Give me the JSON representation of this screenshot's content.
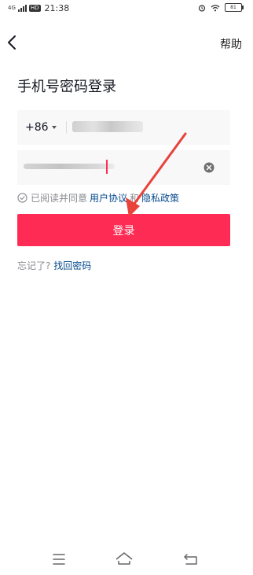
{
  "status_bar": {
    "network": "4G",
    "hd": "HD",
    "time": "21:38",
    "battery": "81"
  },
  "nav": {
    "help": "帮助"
  },
  "title": "手机号密码登录",
  "phone": {
    "country_code": "+86"
  },
  "agreement": {
    "prefix": "已阅读并同意",
    "user_agreement": "用户协议",
    "and": "和",
    "privacy_policy": "隐私政策"
  },
  "login_button": "登录",
  "forgot": {
    "prompt": "忘记了?",
    "link": "找回密码"
  },
  "colors": {
    "accent": "#fe2c55",
    "link": "#04498d",
    "annotation": "#e8423a"
  }
}
